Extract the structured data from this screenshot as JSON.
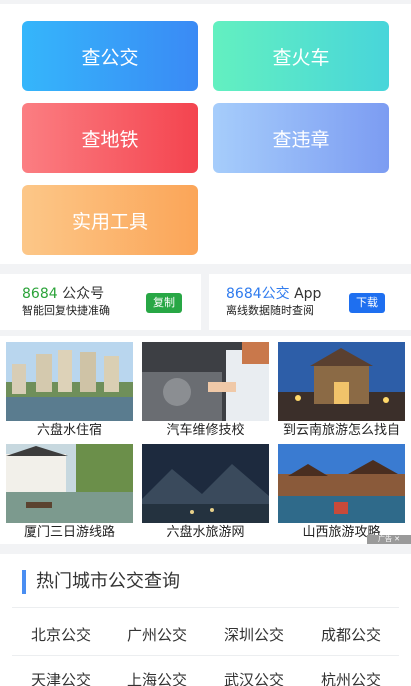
{
  "tiles": [
    "查公交",
    "查火车",
    "查地铁",
    "查违章",
    "实用工具"
  ],
  "promo_left": {
    "num": "8684",
    "rest": " 公众号",
    "sub": "智能回复快捷准确",
    "btn": "复制"
  },
  "promo_right": {
    "num": "8684公交",
    "rest": " App",
    "sub": "离线数据随时查阅",
    "btn": "下载"
  },
  "ads": [
    {
      "caption": "六盘水住宿",
      "icon": "hotel-photo"
    },
    {
      "caption": "汽车维修技校",
      "icon": "car-repair-photo"
    },
    {
      "caption": "到云南旅游怎么找自",
      "icon": "yunnan-gate-photo"
    },
    {
      "caption": "厦门三日游线路",
      "icon": "water-town-photo"
    },
    {
      "caption": "六盘水旅游网",
      "icon": "mountain-night-photo"
    },
    {
      "caption": "山西旅游攻略",
      "icon": "ancient-town-photo"
    }
  ],
  "ad_tag": "广告 ✕",
  "hot": {
    "title": "热门城市公交查询",
    "cities": [
      "北京公交",
      "广州公交",
      "深圳公交",
      "成都公交",
      "天津公交",
      "上海公交",
      "武汉公交",
      "杭州公交"
    ]
  },
  "colors": {
    "accent": "#4a8ef2",
    "green": "#28a745",
    "blue": "#1e6ff0"
  }
}
